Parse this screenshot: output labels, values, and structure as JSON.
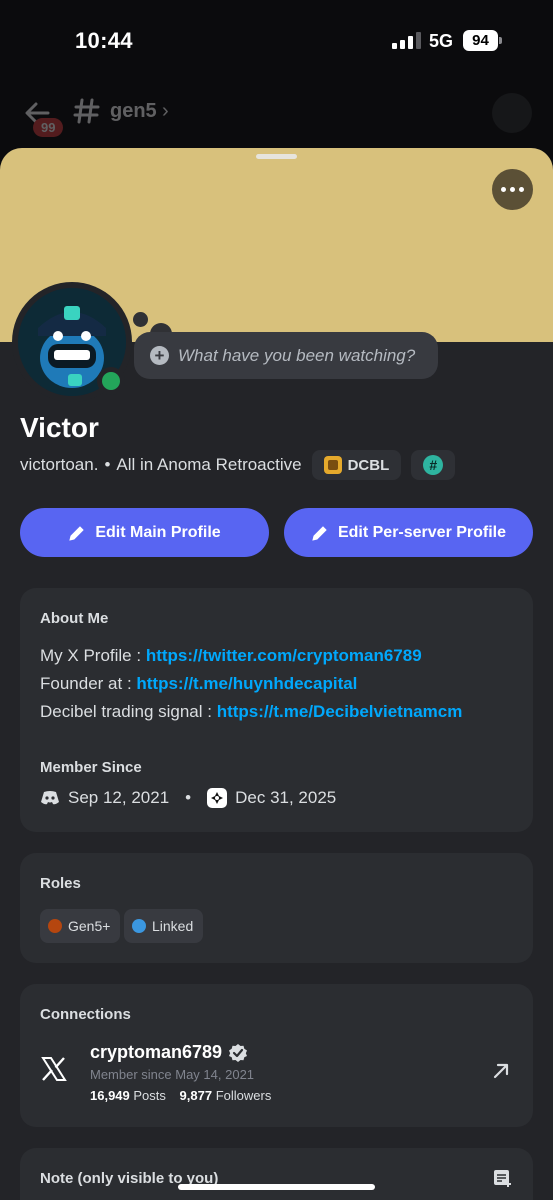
{
  "status_bar": {
    "time": "10:44",
    "network": "5G",
    "battery": "94"
  },
  "channel_header": {
    "unread_badge": "99",
    "channel_name": "gen5",
    "chevron": "›"
  },
  "profile": {
    "display_name": "Victor",
    "username": "victortoan.",
    "separator": "•",
    "custom_status": "All in Anoma Retroactive",
    "server_tag": "DCBL",
    "hash_badge": "#",
    "status_placeholder": "What have you been watching?",
    "online_color": "#23a55a",
    "banner_color": "#d8c17c"
  },
  "actions": {
    "edit_main": "Edit Main Profile",
    "edit_server": "Edit Per-server Profile"
  },
  "about": {
    "title": "About Me",
    "lines": [
      {
        "label": "My X Profile : ",
        "link": "https://twitter.com/cryptoman6789"
      },
      {
        "label": "Founder at : ",
        "link": "https://t.me/huynhdecapital"
      },
      {
        "label": "Decibel trading signal : ",
        "link": "https://t.me/Decibelvietnamcm"
      }
    ],
    "member_since_title": "Member Since",
    "discord_since": "Sep 12, 2021",
    "dot": "•",
    "server_since": "Dec 31, 2025"
  },
  "roles": {
    "title": "Roles",
    "items": [
      {
        "name": "Gen5+",
        "color": "#b5460f"
      },
      {
        "name": "Linked",
        "color": "#3b97e0"
      }
    ]
  },
  "connections": {
    "title": "Connections",
    "account": {
      "name": "cryptoman6789",
      "member_since": "Member since May 14, 2021",
      "posts_count": "16,949",
      "posts_label": "Posts",
      "followers_count": "9,877",
      "followers_label": "Followers"
    }
  },
  "note": {
    "title": "Note (only visible to you)"
  },
  "colors": {
    "accent": "#5865f2",
    "link": "#00a8fc",
    "card": "#2b2d31",
    "sheet": "#232428"
  }
}
